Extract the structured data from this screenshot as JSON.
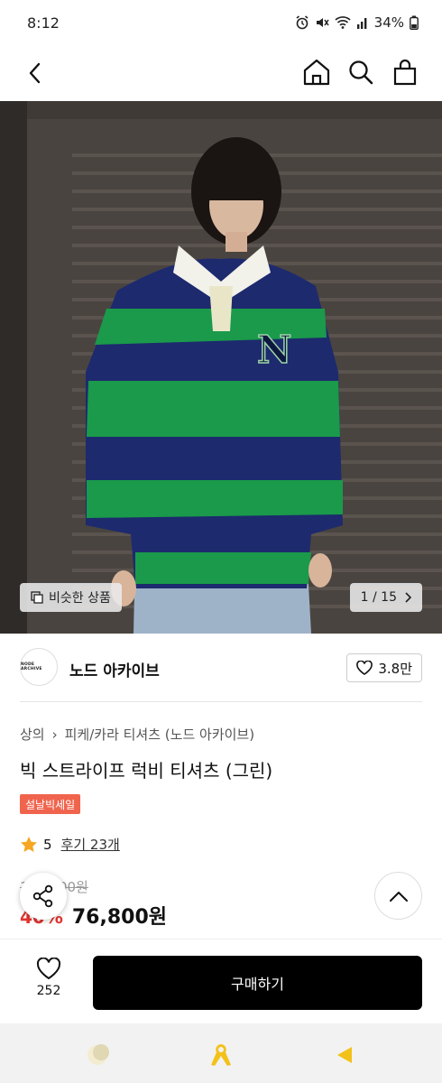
{
  "status_bar": {
    "time": "8:12",
    "battery": "34%"
  },
  "header": {
    "back_icon": "chevron-left-icon",
    "home_icon": "home-icon",
    "search_icon": "search-icon",
    "cart_icon": "shopping-bag-icon"
  },
  "gallery": {
    "similar_label": "비슷한 상품",
    "pager": "1 / 15"
  },
  "brand": {
    "logo_text": "NODE ARCHIVE",
    "name": "노드 아카이브",
    "likes": "3.8만"
  },
  "product": {
    "breadcrumb": [
      "상의",
      "피케/카라 티셔츠 (노드 아카이브)"
    ],
    "title": "빅 스트라이프 럭비 티셔츠 (그린)",
    "badge": "설날빅세일",
    "rating": "5",
    "reviews": "후기 23개",
    "original_price": "128,000원",
    "discount": "40%",
    "price": "76,800원"
  },
  "actions": {
    "wish_count": "252",
    "buy_label": "구매하기"
  },
  "colors": {
    "accent_red": "#e3342f",
    "badge": "#f0644e",
    "star": "#f5a623",
    "stripe_green": "#1a9a4a",
    "stripe_navy": "#1d2a6e"
  }
}
